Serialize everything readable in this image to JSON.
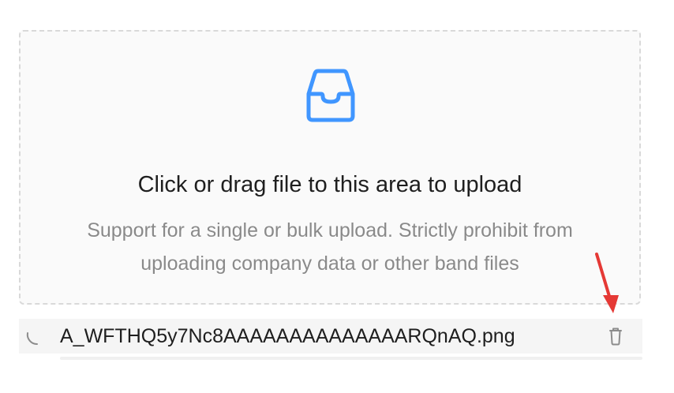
{
  "upload": {
    "icon": "inbox-icon",
    "text": "Click or drag file to this area to upload",
    "hint": "Support for a single or bulk upload. Strictly prohibit from uploading company data or other band files"
  },
  "file_list": [
    {
      "name": "A_WFTHQ5y7Nc8AAAAAAAAAAAAAARQnAQ.png",
      "status_icon": "loading-icon",
      "action_icon": "delete-icon",
      "progress": 0
    }
  ],
  "colors": {
    "accent": "#1677ff",
    "icon_blue": "#4096ff",
    "annotation": "#e53935"
  }
}
